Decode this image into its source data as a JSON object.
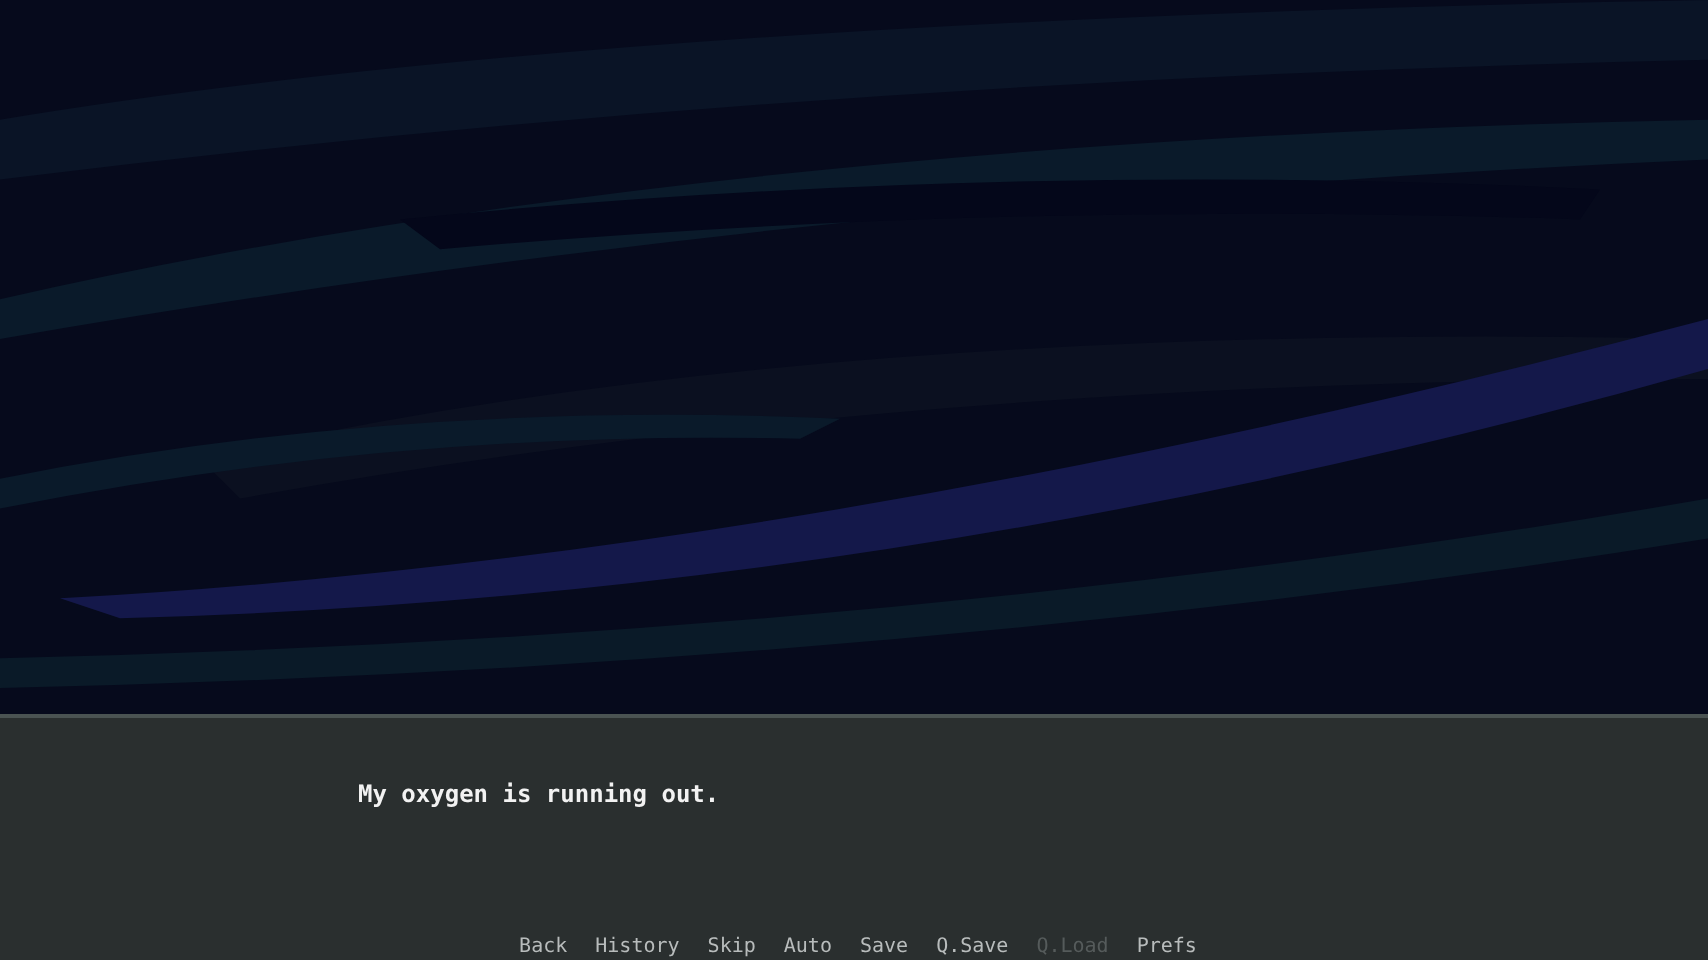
{
  "dialogue": {
    "text": "My oxygen is running out."
  },
  "quick_menu": [
    {
      "label": "Back",
      "disabled": false
    },
    {
      "label": "History",
      "disabled": false
    },
    {
      "label": "Skip",
      "disabled": false
    },
    {
      "label": "Auto",
      "disabled": false
    },
    {
      "label": "Save",
      "disabled": false
    },
    {
      "label": "Q.Save",
      "disabled": false
    },
    {
      "label": "Q.Load",
      "disabled": true
    },
    {
      "label": "Prefs",
      "disabled": false
    }
  ]
}
